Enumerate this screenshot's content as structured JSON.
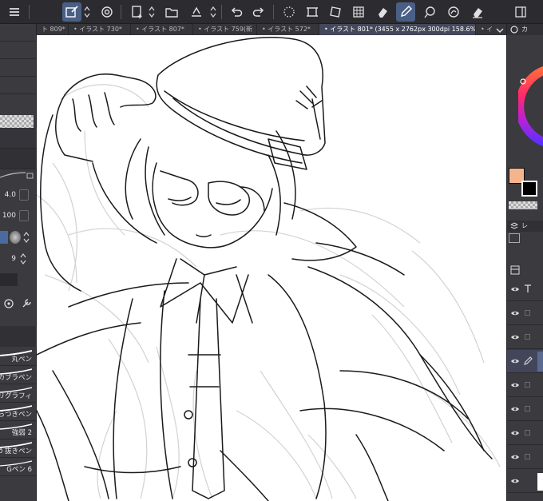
{
  "document_tabs": [
    {
      "label": "ト 809*",
      "active": false
    },
    {
      "label": "• イラスト 730*",
      "active": false
    },
    {
      "label": "• イラスト 807*",
      "active": false
    },
    {
      "label": "• イラスト 759(新",
      "active": false
    },
    {
      "label": "• イラスト 572*",
      "active": false
    },
    {
      "label": "• イラスト 801* (3455 x 2762px 300dpi 158.6%)",
      "active": true
    },
    {
      "label": "• イラス",
      "active": false
    }
  ],
  "tool_property": {
    "brush_size": "4.0",
    "opacity": "100",
    "stabilization": "9"
  },
  "brush_list": [
    {
      "label": "丸ペン"
    },
    {
      "label": "カブラペン"
    },
    {
      "label": "リグラフィ"
    },
    {
      "label": "らつきペン"
    },
    {
      "label": "強弱 2"
    },
    {
      "label": "ð 抜きペン"
    },
    {
      "label": "Gペン 6"
    }
  ],
  "right_panel": {
    "color_header": "カ",
    "layer_header": "レ"
  },
  "colors": {
    "main_color": "#f4b48c",
    "sub_color": "#000000",
    "accent": "#4a5f86"
  }
}
